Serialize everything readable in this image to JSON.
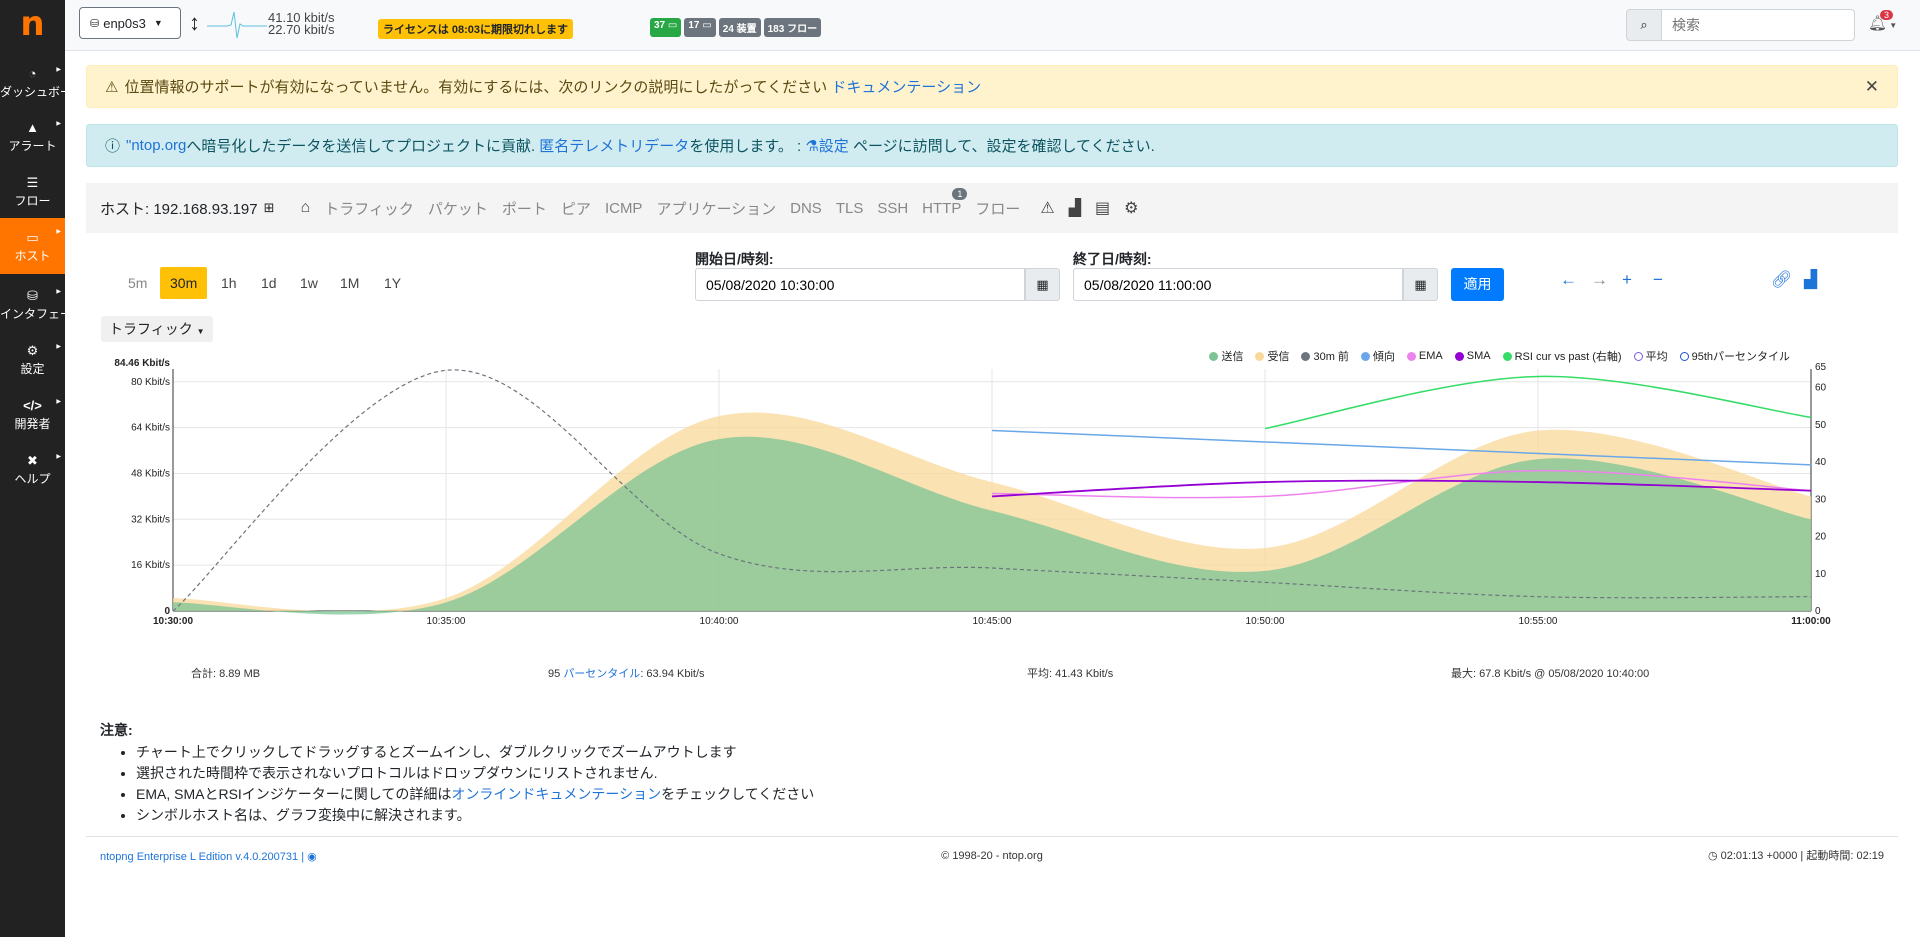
{
  "sidebar": {
    "logo": "n",
    "items": [
      {
        "label": "ダッシュボード",
        "icon": "gauge-icon"
      },
      {
        "label": "アラート",
        "icon": "warning-icon"
      },
      {
        "label": "フロー",
        "icon": "list-icon"
      },
      {
        "label": "ホスト",
        "icon": "laptop-icon"
      },
      {
        "label": "インタフェース",
        "icon": "network-icon"
      },
      {
        "label": "設定",
        "icon": "gear-icon"
      },
      {
        "label": "開発者",
        "icon": "code-icon"
      },
      {
        "label": "ヘルプ",
        "icon": "help-icon"
      }
    ]
  },
  "topbar": {
    "interface": "enp0s3",
    "rate_up": "41.10 kbit/s",
    "rate_down": "22.70 kbit/s",
    "license": "ライセンスは 08:03に期限切れします",
    "badge_hosts": "37",
    "badge_devices_local": "17",
    "badge_devices": "24 装置",
    "badge_flows": "183 フロー",
    "search_placeholder": "検索",
    "alerts_count": "3"
  },
  "alerts": {
    "warning_text": "位置情報のサポートが有効になっていません。有効にするには、次のリンクの説明にしたがってください",
    "warning_link": "ドキュメンテーション",
    "info_link1": "\"ntop.org",
    "info_text1": "へ暗号化したデータを送信してプロジェクトに貢献.",
    "info_link2": "匿名テレメトリデータ",
    "info_text2": "を使用します。 :",
    "info_link3": "設定",
    "info_text3": "ページに訪問して、設定を確認してください."
  },
  "hostnav": {
    "host_label": "ホスト: 192.168.93.197",
    "tabs": [
      "トラフィック",
      "パケット",
      "ポート",
      "ピア",
      "ICMP",
      "アプリケーション",
      "DNS",
      "TLS",
      "SSH",
      "HTTP",
      "フロー"
    ],
    "http_count": "1"
  },
  "timebar": {
    "ranges": [
      "5m",
      "30m",
      "1h",
      "1d",
      "1w",
      "1M",
      "1Y"
    ],
    "active": "30m",
    "start_label": "開始日/時刻:",
    "start_value": "05/08/2020 10:30:00",
    "end_label": "終了日/時刻:",
    "end_value": "05/08/2020 11:00:00",
    "apply": "適用"
  },
  "metric_select": "トラフィック",
  "chart_data": {
    "type": "area",
    "x": [
      "10:30:00",
      "10:35:00",
      "10:40:00",
      "10:45:00",
      "10:50:00",
      "10:55:00",
      "11:00:00"
    ],
    "y_left_ticks": [
      "0",
      "16 Kbit/s",
      "32 Kbit/s",
      "48 Kbit/s",
      "64 Kbit/s",
      "80 Kbit/s",
      "84.46 Kbit/s"
    ],
    "y_right_ticks": [
      "0",
      "10",
      "20",
      "30",
      "40",
      "50",
      "60",
      "65"
    ],
    "ylim_left": [
      0,
      84.46
    ],
    "ylim_right": [
      0,
      65
    ],
    "series": [
      {
        "name": "送信",
        "color": "#7cc494",
        "x_min": [
          0,
          5,
          10,
          15,
          20,
          25,
          30
        ],
        "values": [
          3,
          3,
          60,
          35,
          14,
          53,
          32
        ]
      },
      {
        "name": "受信",
        "color": "#fad89a",
        "x_min": [
          0,
          5,
          10,
          15,
          20,
          25,
          30
        ],
        "values": [
          4.5,
          4.5,
          68,
          45,
          22,
          63,
          40
        ]
      },
      {
        "name": "30m 前",
        "color": "#6c757d",
        "x_min": [
          0,
          5,
          10,
          15,
          20,
          25,
          30
        ],
        "values": [
          0,
          84,
          20,
          15,
          10,
          5,
          5
        ]
      },
      {
        "name": "傾向",
        "color": "#6aa7e8",
        "x_min": [
          15,
          30
        ],
        "values": [
          63,
          51
        ]
      },
      {
        "name": "EMA",
        "color": "#ee82ee",
        "x_min": [
          15,
          20,
          25,
          30
        ],
        "values": [
          41,
          40,
          49,
          42
        ]
      },
      {
        "name": "SMA",
        "color": "#9400d3",
        "x_min": [
          15,
          20,
          25,
          30
        ],
        "values": [
          40,
          45,
          45,
          42
        ]
      },
      {
        "name": "RSI cur vs past (右軸)",
        "color": "#33dd66",
        "axis": "right",
        "x_min": [
          20,
          25,
          30
        ],
        "values": [
          49,
          63,
          52
        ]
      },
      {
        "name": "平均",
        "color": "#7a5ce0",
        "ring": true
      },
      {
        "name": "95thパーセンタイル",
        "color": "#1e4fd8",
        "ring": true
      }
    ]
  },
  "stats": {
    "total": "合計: 8.89 MB",
    "pct_prefix": "95",
    "pct_link": "パーセンタイル",
    "pct_value": ": 63.94 Kbit/s",
    "avg": "平均: 41.43 Kbit/s",
    "max": "最大: 67.8 Kbit/s @ 05/08/2020 10:40:00"
  },
  "notes": {
    "title": "注意:",
    "items": [
      "チャート上でクリックしてドラッグするとズームインし、ダブルクリックでズームアウトします",
      "選択された時間枠で表示されないプロトコルはドロップダウンにリストされません.",
      "シンボルホスト名は、グラフ変換中に解決されます。"
    ],
    "ema_prefix": "EMA, SMAとRSIインジケーターに関しての詳細は",
    "ema_link": "オンラインドキュメンテーション",
    "ema_suffix": "をチェックしてください"
  },
  "footer": {
    "edition": "ntopng Enterprise L Edition v.4.0.200731 |",
    "copyright": "© 1998-20 - ntop.org",
    "uptime": "02:01:13 +0000 | 起動時間: 02:19"
  }
}
